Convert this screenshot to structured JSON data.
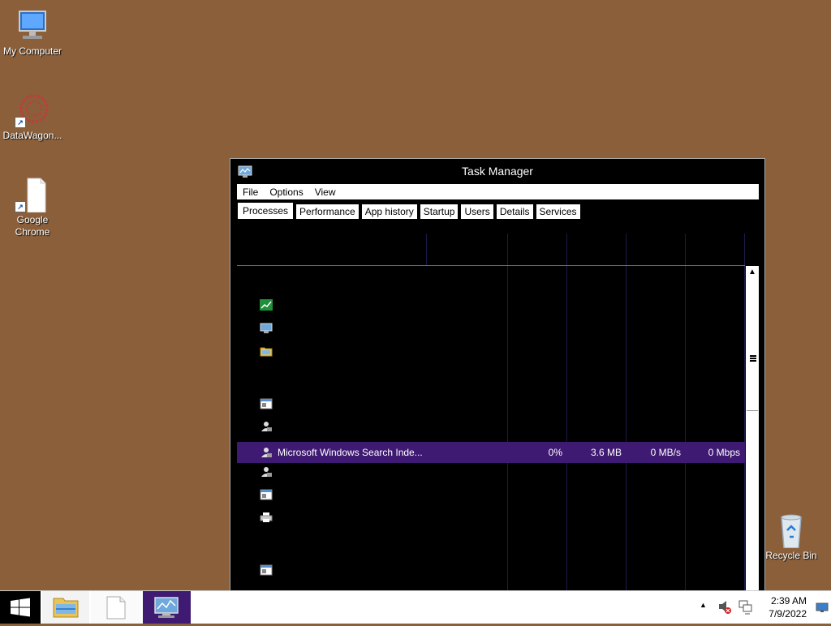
{
  "desktop": {
    "icons": [
      {
        "label": "My Computer"
      },
      {
        "label": "DataWagon..."
      },
      {
        "label": "Google Chrome"
      },
      {
        "label": "Recycle Bin"
      }
    ]
  },
  "task_manager": {
    "title": "Task Manager",
    "menu": [
      "File",
      "Options",
      "View"
    ],
    "tabs": [
      "Processes",
      "Performance",
      "App history",
      "Startup",
      "Users",
      "Details",
      "Services"
    ],
    "active_tab": "Processes",
    "selected_process": {
      "name": "Microsoft Windows Search Inde...",
      "cpu": "0%",
      "memory": "3.6 MB",
      "disk": "0 MB/s",
      "network": "0 Mbps"
    }
  },
  "taskbar": {
    "clock_time": "2:39 AM",
    "clock_date": "7/9/2022"
  },
  "colors": {
    "desktop_bg": "#8a5f3a",
    "selection": "#3f1a72"
  }
}
